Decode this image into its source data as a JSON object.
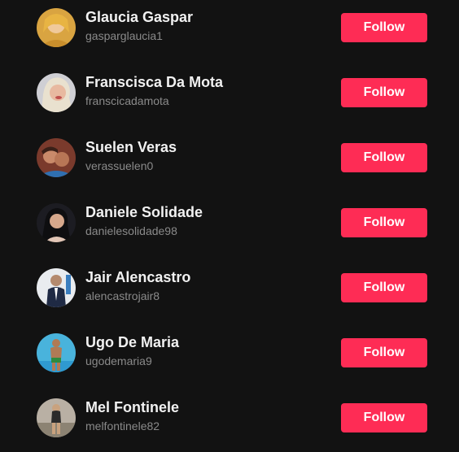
{
  "colors": {
    "background": "#121212",
    "name_text": "#f1f1f1",
    "handle_text": "#8a8a8a",
    "follow_button": "#fe2c55"
  },
  "accounts": [
    {
      "name": "Glaucia Gaspar",
      "handle": "gasparglaucia1",
      "button": "Follow"
    },
    {
      "name": "Franscisca Da Mota",
      "handle": "franscicadamota",
      "button": "Follow"
    },
    {
      "name": "Suelen Veras",
      "handle": "verassuelen0",
      "button": "Follow"
    },
    {
      "name": "Daniele Solidade",
      "handle": "danielesolidade98",
      "button": "Follow"
    },
    {
      "name": "Jair Alencastro",
      "handle": "alencastrojair8",
      "button": "Follow"
    },
    {
      "name": "Ugo De Maria",
      "handle": "ugodemaria9",
      "button": "Follow"
    },
    {
      "name": "Mel Fontinele",
      "handle": "melfontinele82",
      "button": "Follow"
    }
  ]
}
